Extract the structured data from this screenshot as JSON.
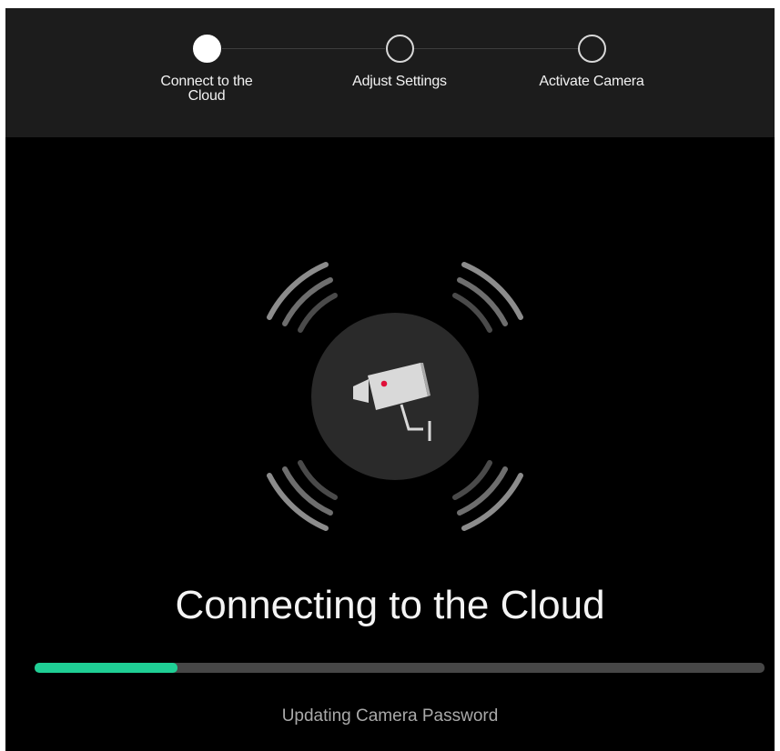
{
  "wizard": {
    "steps": [
      {
        "label": "Connect to the Cloud",
        "state": "active"
      },
      {
        "label": "Adjust Settings",
        "state": "pending"
      },
      {
        "label": "Activate Camera",
        "state": "pending"
      }
    ]
  },
  "main": {
    "illustration_icon": "security-camera-icon",
    "title": "Connecting to the Cloud",
    "progress": 0.196,
    "status": "Updating Camera Password"
  },
  "colors": {
    "background": "#000000",
    "header_background": "#1c1c1c",
    "progress_accent": "#1fcf95",
    "progress_track": "#474747",
    "camera_led": "#e0103a"
  }
}
